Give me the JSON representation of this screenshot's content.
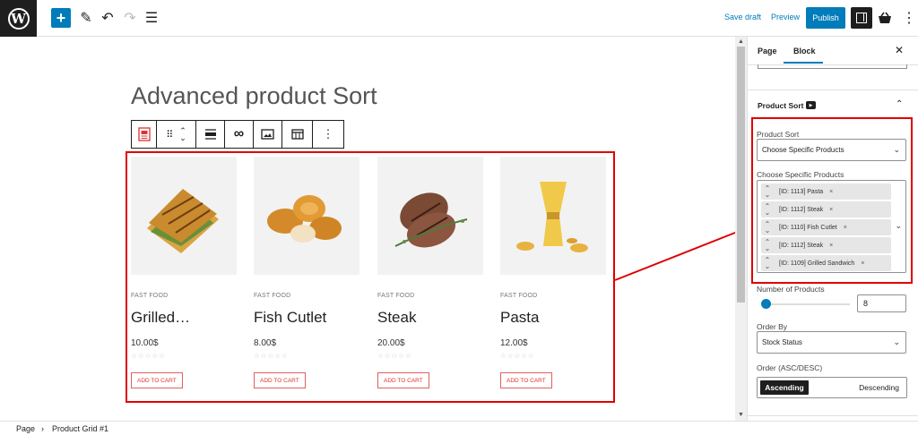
{
  "topbar": {
    "logo": "W",
    "save_draft": "Save draft",
    "preview": "Preview",
    "publish": "Publish"
  },
  "editor": {
    "page_title": "Advanced product Sort"
  },
  "products": [
    {
      "category": "FAST FOOD",
      "name": "Grilled…",
      "price": "10.00$",
      "cart": "ADD TO CART"
    },
    {
      "category": "FAST FOOD",
      "name": "Fish Cutlet",
      "price": "8.00$",
      "cart": "ADD TO CART"
    },
    {
      "category": "FAST FOOD",
      "name": "Steak",
      "price": "20.00$",
      "cart": "ADD TO CART"
    },
    {
      "category": "FAST FOOD",
      "name": "Pasta",
      "price": "12.00$",
      "cart": "ADD TO CART"
    }
  ],
  "panel": {
    "tabs": [
      "Page",
      "Block"
    ],
    "section_title": "Product Sort",
    "product_sort_label": "Product Sort",
    "product_sort_value": "Choose Specific Products",
    "choose_label": "Choose Specific Products",
    "selected_products": [
      "[ID: 1113] Pasta",
      "[ID: 1112] Steak",
      "[ID: 1110] Fish Cutlet",
      "[ID: 1112] Steak",
      "[ID: 1109] Grilled Sandwich"
    ],
    "num_products_label": "Number of Products",
    "num_products_value": "8",
    "order_by_label": "Order By",
    "order_by_value": "Stock Status",
    "order_label": "Order (ASC/DESC)",
    "order_asc": "Ascending",
    "order_desc": "Descending"
  },
  "breadcrumb": {
    "root": "Page",
    "current": "Product Grid #1"
  },
  "colors": {
    "accent": "#007cba",
    "highlight": "#e00000"
  }
}
